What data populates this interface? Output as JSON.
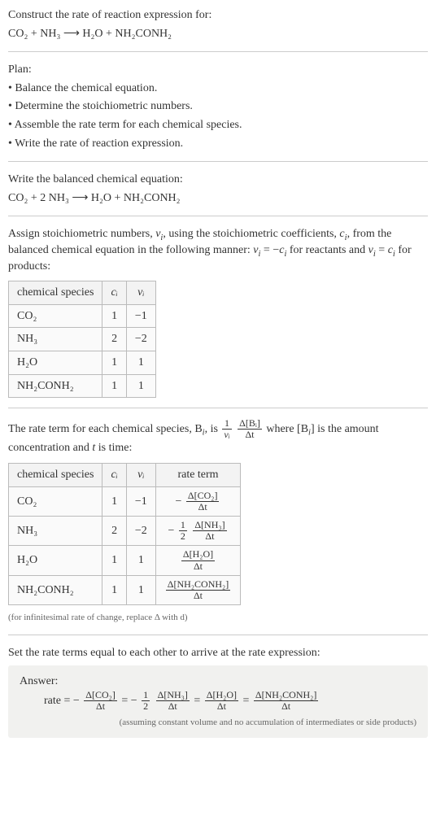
{
  "intro": {
    "construct_line": "Construct the rate of reaction expression for:",
    "reaction_unbalanced": "CO₂ + NH₃  ⟶  H₂O + NH₂CONH₂"
  },
  "plan": {
    "heading": "Plan:",
    "step1": "• Balance the chemical equation.",
    "step2": "• Determine the stoichiometric numbers.",
    "step3": "• Assemble the rate term for each chemical species.",
    "step4": "• Write the rate of reaction expression."
  },
  "balanced": {
    "heading": "Write the balanced chemical equation:",
    "reaction": "CO₂ + 2 NH₃  ⟶  H₂O + NH₂CONH₂"
  },
  "stoich": {
    "text_a": "Assign stoichiometric numbers, ",
    "nu_i": "ν",
    "text_b": ", using the stoichiometric coefficients, ",
    "c_i": "c",
    "text_c": ", from the balanced chemical equation in the following manner: ",
    "rel_reactants": " = −",
    "text_d": " for reactants and ",
    "rel_products": " = ",
    "text_e": " for products:",
    "table": {
      "h1": "chemical species",
      "h2": "cᵢ",
      "h3": "νᵢ",
      "rows": [
        {
          "species": "CO₂",
          "c": "1",
          "nu": "−1"
        },
        {
          "species": "NH₃",
          "c": "2",
          "nu": "−2"
        },
        {
          "species": "H₂O",
          "c": "1",
          "nu": "1"
        },
        {
          "species": "NH₂CONH₂",
          "c": "1",
          "nu": "1"
        }
      ]
    }
  },
  "rate_term": {
    "text_a": "The rate term for each chemical species, B",
    "text_b": ", is ",
    "frac1_num": "1",
    "frac1_den": "νᵢ",
    "frac2_num": "Δ[Bᵢ]",
    "frac2_den": "Δt",
    "text_c": " where [B",
    "text_d": "] is the amount concentration and ",
    "t": "t",
    "text_e": " is time:",
    "table": {
      "h1": "chemical species",
      "h2": "cᵢ",
      "h3": "νᵢ",
      "h4": "rate term",
      "rows": [
        {
          "species": "CO₂",
          "c": "1",
          "nu": "−1",
          "rate_prefix": "−",
          "rate_coef": "",
          "rate_num": "Δ[CO₂]",
          "rate_den": "Δt"
        },
        {
          "species": "NH₃",
          "c": "2",
          "nu": "−2",
          "rate_prefix": "−",
          "rate_coef_num": "1",
          "rate_coef_den": "2",
          "rate_num": "Δ[NH₃]",
          "rate_den": "Δt"
        },
        {
          "species": "H₂O",
          "c": "1",
          "nu": "1",
          "rate_prefix": "",
          "rate_coef": "",
          "rate_num": "Δ[H₂O]",
          "rate_den": "Δt"
        },
        {
          "species": "NH₂CONH₂",
          "c": "1",
          "nu": "1",
          "rate_prefix": "",
          "rate_coef": "",
          "rate_num": "Δ[NH₂CONH₂]",
          "rate_den": "Δt"
        }
      ]
    },
    "footnote": "(for infinitesimal rate of change, replace Δ with d)"
  },
  "final": {
    "heading": "Set the rate terms equal to each other to arrive at the rate expression:",
    "answer_label": "Answer:",
    "rate_label": "rate = −",
    "t1_num": "Δ[CO₂]",
    "t1_den": "Δt",
    "eq": " = −",
    "coef_num": "1",
    "coef_den": "2",
    "t2_num": "Δ[NH₃]",
    "t2_den": "Δt",
    "eq2": " = ",
    "t3_num": "Δ[H₂O]",
    "t3_den": "Δt",
    "eq3": " = ",
    "t4_num": "Δ[NH₂CONH₂]",
    "t4_den": "Δt",
    "assumption": "(assuming constant volume and no accumulation of intermediates or side products)"
  }
}
